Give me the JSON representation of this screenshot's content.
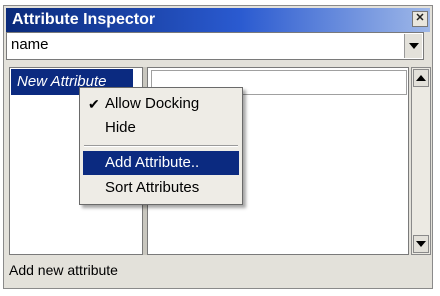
{
  "window": {
    "title": "Attribute Inspector"
  },
  "combo": {
    "value": "name"
  },
  "list": {
    "items": [
      "New Attribute"
    ]
  },
  "status": {
    "text": "Add new attribute"
  },
  "context_menu": {
    "items": [
      {
        "label": "Allow Docking",
        "checked": true
      },
      {
        "label": "Hide",
        "checked": false
      },
      {
        "label": "Add Attribute..",
        "highlighted": true
      },
      {
        "label": "Sort Attributes"
      }
    ]
  },
  "colors": {
    "title_start": "#0a2a7a",
    "title_end": "#9fb8e8",
    "selection": "#0b2a80",
    "panel": "#e3e1da"
  }
}
